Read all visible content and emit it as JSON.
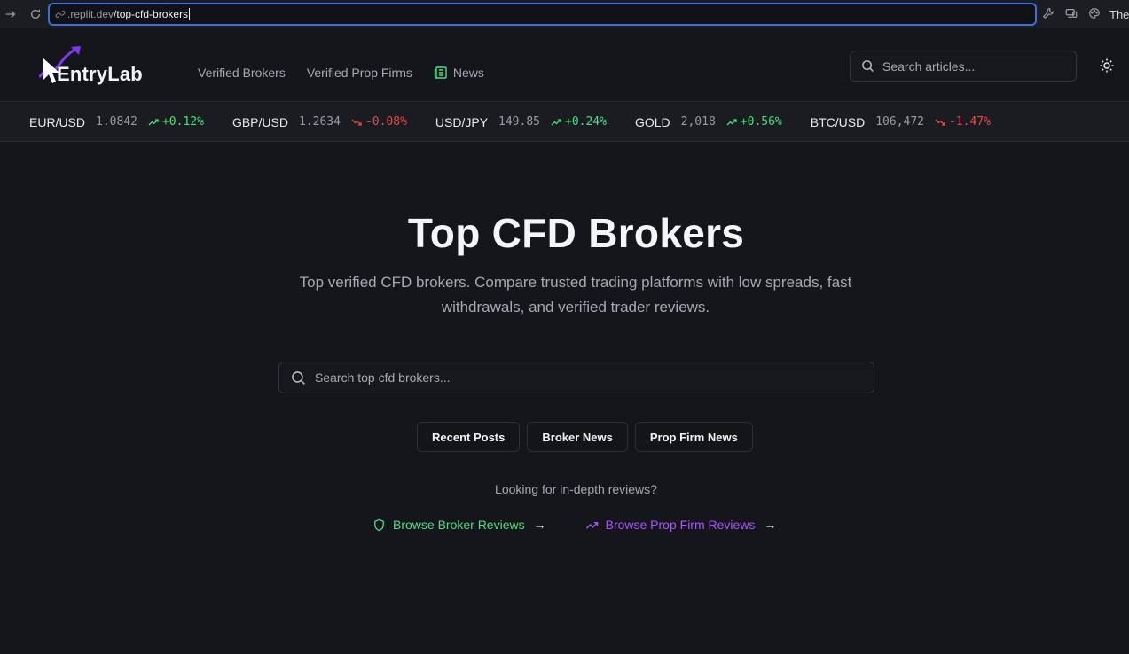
{
  "browser": {
    "url_domain": ".replit.dev",
    "url_path": "/top-cfd-brokers",
    "tab_fragment": "The"
  },
  "header": {
    "logo_text": "EntryLab",
    "nav": {
      "brokers": "Verified Brokers",
      "prop_firms": "Verified Prop Firms",
      "news": "News"
    },
    "search_placeholder": "Search articles..."
  },
  "ticker": [
    {
      "symbol": "EUR/USD",
      "price": "1.0842",
      "change": "+0.12%",
      "direction": "up"
    },
    {
      "symbol": "GBP/USD",
      "price": "1.2634",
      "change": "-0.08%",
      "direction": "down"
    },
    {
      "symbol": "USD/JPY",
      "price": "149.85",
      "change": "+0.24%",
      "direction": "up"
    },
    {
      "symbol": "GOLD",
      "price": "2,018",
      "change": "+0.56%",
      "direction": "up"
    },
    {
      "symbol": "BTC/USD",
      "price": "106,472",
      "change": "-1.47%",
      "direction": "down"
    }
  ],
  "hero": {
    "title": "Top CFD Brokers",
    "subtitle": "Top verified CFD brokers. Compare trusted trading platforms with low spreads, fast withdrawals, and verified trader reviews.",
    "search_placeholder": "Search top cfd brokers..."
  },
  "filters": {
    "recent": "Recent Posts",
    "broker_news": "Broker News",
    "prop_news": "Prop Firm News"
  },
  "reviews": {
    "prompt": "Looking for in-depth reviews?",
    "broker_link": "Browse Broker Reviews",
    "prop_link": "Browse Prop Firm Reviews",
    "arrow": "→"
  },
  "colors": {
    "background": "#15161b",
    "accent_green": "#4ade80",
    "accent_purple": "#a855f7",
    "negative_red": "#ef4444",
    "focus_blue": "#3b6fd9"
  }
}
